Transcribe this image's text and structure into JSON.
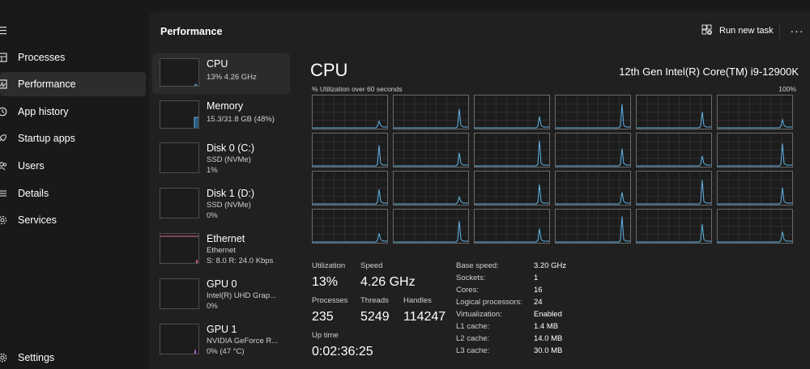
{
  "nav": {
    "items": [
      {
        "label": "Processes",
        "icon": "processes-icon"
      },
      {
        "label": "Performance",
        "icon": "performance-icon"
      },
      {
        "label": "App history",
        "icon": "history-icon"
      },
      {
        "label": "Startup apps",
        "icon": "startup-icon"
      },
      {
        "label": "Users",
        "icon": "users-icon"
      },
      {
        "label": "Details",
        "icon": "details-icon"
      },
      {
        "label": "Services",
        "icon": "services-icon"
      }
    ],
    "settings_label": "Settings"
  },
  "header": {
    "title": "Performance",
    "run_new_task": "Run new task",
    "more": "···"
  },
  "resources": [
    {
      "name": "CPU",
      "lines": [
        "13%  4.26 GHz"
      ]
    },
    {
      "name": "Memory",
      "lines": [
        "15.3/31.8 GB (48%)"
      ]
    },
    {
      "name": "Disk 0 (C:)",
      "lines": [
        "SSD (NVMe)",
        "1%"
      ]
    },
    {
      "name": "Disk 1 (D:)",
      "lines": [
        "SSD (NVMe)",
        "0%"
      ]
    },
    {
      "name": "Ethernet",
      "lines": [
        "Ethernet",
        "S: 8.0  R: 24.0 Kbps"
      ]
    },
    {
      "name": "GPU 0",
      "lines": [
        "Intel(R) UHD Grap...",
        "0%"
      ]
    },
    {
      "name": "GPU 1",
      "lines": [
        "NVIDIA GeForce R...",
        "0% (47 °C)"
      ]
    }
  ],
  "cpu": {
    "title": "CPU",
    "model": "12th Gen Intel(R) Core(TM) i9-12900K",
    "util_label": "% Utilization over 60 seconds",
    "util_max": "100%",
    "core_count_shown": 24,
    "stats": {
      "utilization_label": "Utilization",
      "utilization": "13%",
      "speed_label": "Speed",
      "speed": "4.26 GHz",
      "processes_label": "Processes",
      "processes": "235",
      "threads_label": "Threads",
      "threads": "5249",
      "handles_label": "Handles",
      "handles": "114247",
      "uptime_label": "Up time",
      "uptime": "0:02:36:25"
    },
    "specs": [
      {
        "label": "Base speed:",
        "value": "3.20 GHz"
      },
      {
        "label": "Sockets:",
        "value": "1"
      },
      {
        "label": "Cores:",
        "value": "16"
      },
      {
        "label": "Logical processors:",
        "value": "24"
      },
      {
        "label": "Virtualization:",
        "value": "Enabled"
      },
      {
        "label": "L1 cache:",
        "value": "1.4 MB"
      },
      {
        "label": "L2 cache:",
        "value": "14.0 MB"
      },
      {
        "label": "L3 cache:",
        "value": "30.0 MB"
      }
    ]
  },
  "colors": {
    "cpu_line": "#5fb4e6",
    "memory_line": "#5fb4e6",
    "ethernet_line": "#e06a8a",
    "gpu_line": "#b16ad8",
    "selected_bg": "#2b2b2b"
  }
}
